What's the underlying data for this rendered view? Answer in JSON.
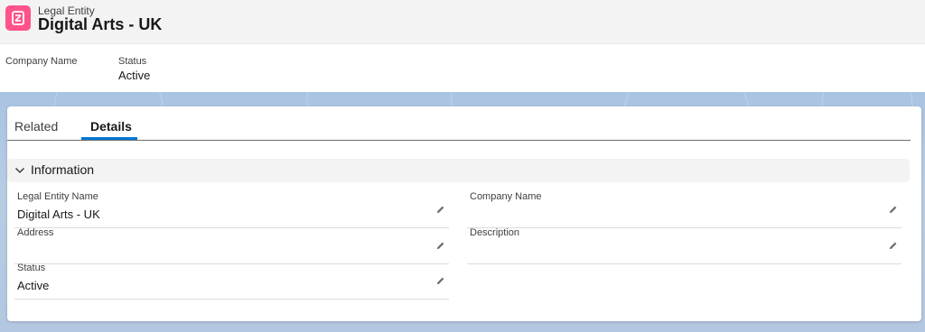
{
  "header": {
    "object_label": "Legal Entity",
    "record_title": "Digital Arts - UK",
    "icon": "legal-entity-icon",
    "icon_color": "#ff538a"
  },
  "highlights": [
    {
      "label": "Company Name",
      "value": ""
    },
    {
      "label": "Status",
      "value": "Active"
    }
  ],
  "tabs": [
    {
      "label": "Related",
      "active": false
    },
    {
      "label": "Details",
      "active": true
    }
  ],
  "section": {
    "title": "Information",
    "expanded": true,
    "icon": "chevron-down-icon"
  },
  "fields": {
    "legal_entity_name": {
      "label": "Legal Entity Name",
      "value": "Digital Arts - UK"
    },
    "company_name": {
      "label": "Company Name",
      "value": ""
    },
    "address": {
      "label": "Address",
      "value": ""
    },
    "description": {
      "label": "Description",
      "value": ""
    },
    "status": {
      "label": "Status",
      "value": "Active"
    }
  },
  "colors": {
    "accent": "#0176d3",
    "background_band": "#b0c4df"
  }
}
